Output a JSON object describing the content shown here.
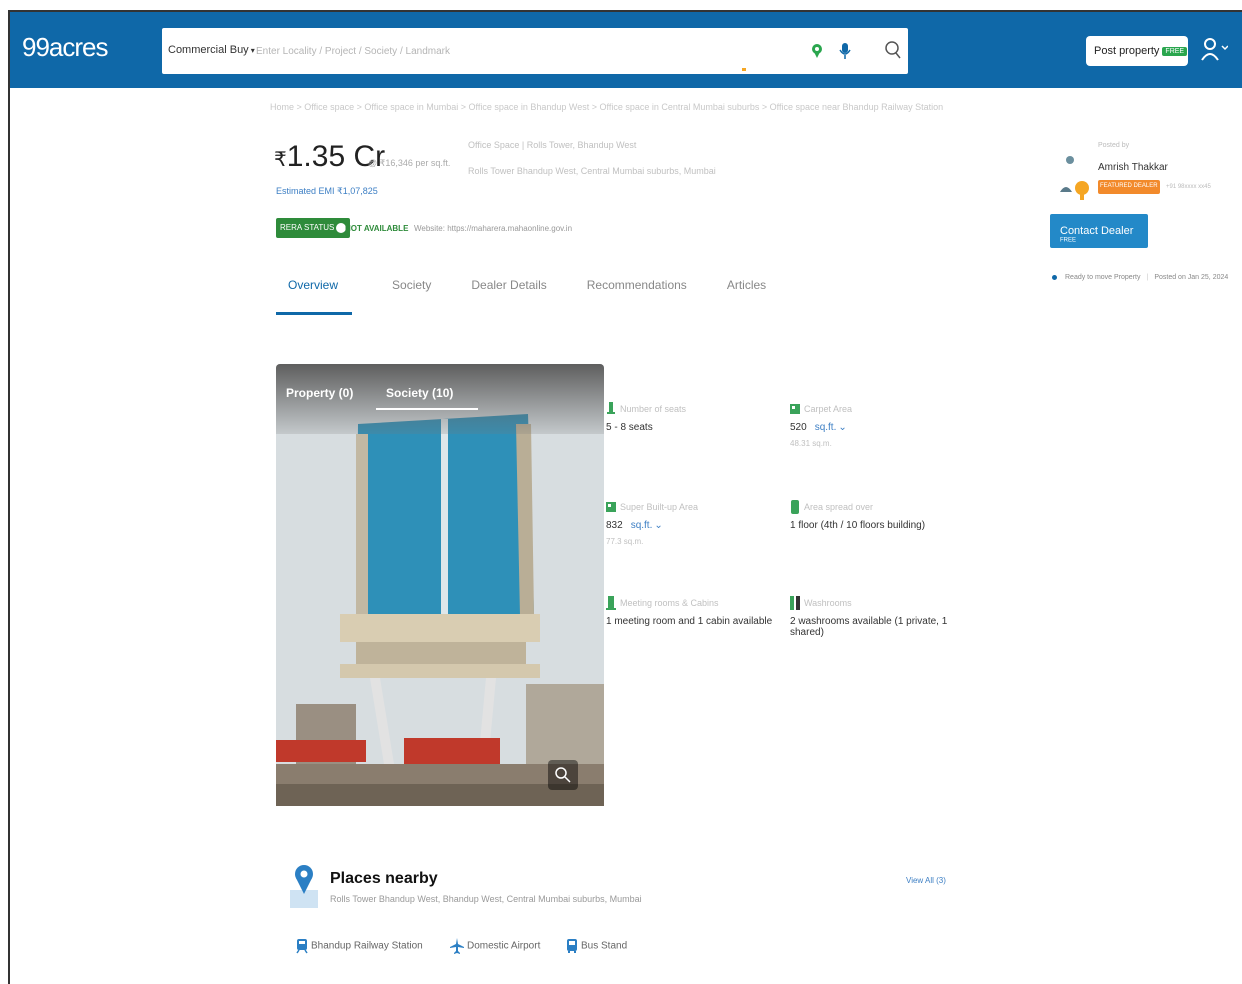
{
  "header": {
    "logo": "99acres",
    "search_type": "Commercial Buy",
    "search_placeholder": "Enter Locality / Project / Society / Landmark",
    "post_property": "Post property",
    "post_badge": "FREE"
  },
  "breadcrumb": "Home > Office space > Office space in Mumbai > Office space in Bhandup West > Office space in Central Mumbai suburbs > Office space near Bhandup Railway Station",
  "listing": {
    "price": "1.35 Cr",
    "currency": "₹",
    "price_per_sqft": "@ ₹16,346 per sq.ft.",
    "emi": "Estimated EMI ₹1,07,825",
    "project_name": "Office Space | Rolls Tower, Bhandup West",
    "project_location": "Rolls Tower Bhandup West, Central Mumbai suburbs, Mumbai",
    "rera_status": "RERA STATUS",
    "rera_value": "NOT AVAILABLE",
    "rera_site": "Website: https://maharera.mahaonline.gov.in"
  },
  "tabs": [
    {
      "label": "Overview",
      "active": true
    },
    {
      "label": "Society",
      "active": false
    },
    {
      "label": "Dealer Details",
      "active": false
    },
    {
      "label": "Recommendations",
      "active": false
    },
    {
      "label": "Articles",
      "active": false
    }
  ],
  "dealer": {
    "label": "Posted by",
    "name": "Amrish Thakkar",
    "badge": "FEATURED DEALER",
    "sub": "+91 98xxxx xx45",
    "contact_label": "Contact Dealer",
    "contact_badge": "FREE",
    "status": "Ready to move Property",
    "posted": "Posted on Jan 25, 2024"
  },
  "gallery": {
    "tab_property": "Property (0)",
    "tab_society": "Society (10)"
  },
  "features": [
    {
      "label": "Number of seats",
      "value": "5 - 8 seats",
      "unit": "",
      "sub": ""
    },
    {
      "label": "Carpet Area",
      "value": "520",
      "unit": "sq.ft.",
      "sub": "48.31 sq.m."
    },
    {
      "label": "Super Built-up Area",
      "value": "832",
      "unit": "sq.ft.",
      "sub": "77.3 sq.m."
    },
    {
      "label": "Area spread over",
      "value": "1 floor (4th / 10 floors building)",
      "unit": "",
      "sub": ""
    },
    {
      "label": "Meeting rooms & Cabins",
      "value": "1 meeting room and 1 cabin available",
      "unit": "",
      "sub": ""
    },
    {
      "label": "Washrooms",
      "value": "2 washrooms available (1 private, 1 shared)",
      "unit": "",
      "sub": ""
    }
  ],
  "places": {
    "title": "Places nearby",
    "address": "Rolls Tower Bhandup West, Bhandup West, Central Mumbai suburbs, Mumbai",
    "view_all": "View All (3)",
    "items": [
      "Bhandup Railway Station",
      "Domestic Airport",
      "Bus Stand"
    ]
  },
  "colors": {
    "brand": "#0f68a8",
    "accent": "#2389c8",
    "rera_green": "#2e8b3a",
    "badge_orange": "#f28a2b"
  }
}
